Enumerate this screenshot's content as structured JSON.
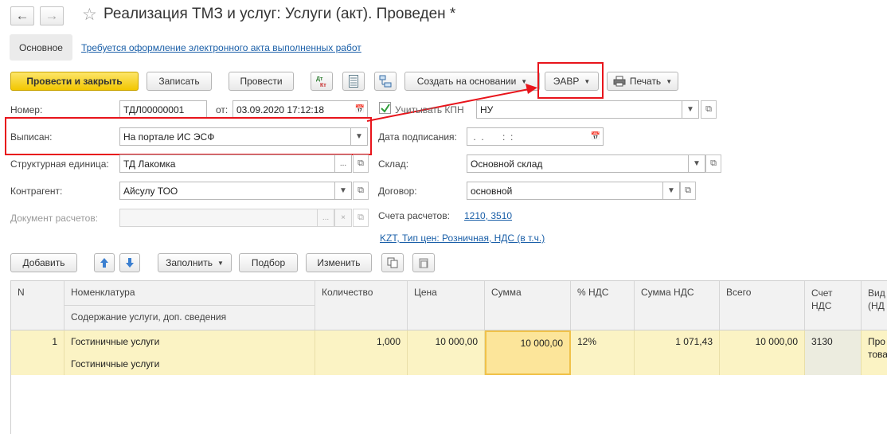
{
  "header": {
    "back_icon": "arrow-left-icon",
    "forward_icon": "arrow-right-icon",
    "favorite_icon": "star-icon",
    "title": "Реализация ТМЗ и услуг: Услуги (акт). Проведен *"
  },
  "tabs": {
    "main": "Основное",
    "link": "Требуется оформление электронного акта выполненных работ"
  },
  "toolbar": {
    "post_close": "Провести и закрыть",
    "save": "Записать",
    "post": "Провести",
    "dtkt_icon": "dt-kt-icon",
    "list_icon": "document-list-icon",
    "structure_icon": "structure-icon",
    "create_based": "Создать на основании",
    "eavr": "ЭАВР",
    "print_icon": "printer-icon",
    "print": "Печать"
  },
  "form": {
    "number_label": "Номер:",
    "number_value": "ТДЛ00000001",
    "from_label": "от:",
    "date_value": "03.09.2020 17:12:18",
    "kpn_label": "Учитывать КПН",
    "kpn_checked": true,
    "kpn_value": "НУ",
    "issued_label": "Выписан:",
    "issued_value": "На портале ИС ЭСФ",
    "sign_date_label": "Дата подписания:",
    "sign_date_value": " .  .       :  :",
    "unit_label": "Структурная единица:",
    "unit_value": "ТД Лакомка",
    "warehouse_label": "Склад:",
    "warehouse_value": "Основной склад",
    "counterparty_label": "Контрагент:",
    "counterparty_value": "Айсулу ТОО",
    "contract_label": "Договор:",
    "contract_value": "основной",
    "settlement_doc_label": "Документ расчетов:",
    "settlement_doc_value": "",
    "accounts_label": "Счета расчетов:",
    "accounts_link": "1210, 3510",
    "price_type_link": "KZT, Тип цен: Розничная, НДС (в т.ч.)"
  },
  "table_toolbar": {
    "add": "Добавить",
    "up_icon": "arrow-up-icon",
    "down_icon": "arrow-down-icon",
    "fill": "Заполнить",
    "selection": "Подбор",
    "change": "Изменить",
    "copy_icon": "copy-icon",
    "paste_icon": "paste-icon"
  },
  "table": {
    "columns": {
      "n": "N",
      "nomenclature": "Номенклатура",
      "content": "Содержание услуги, доп. сведения",
      "qty": "Количество",
      "price": "Цена",
      "sum": "Сумма",
      "vat_rate": "% НДС",
      "vat_sum": "Сумма НДС",
      "total": "Всего",
      "vat_account_1": "Счет",
      "vat_account_2": "НДС",
      "kind_1": "Вид",
      "kind_2": "(НД"
    },
    "rows": [
      {
        "n": "1",
        "nomenclature": "Гостиничные услуги",
        "content": "Гостиничные услуги",
        "qty": "1,000",
        "price": "10 000,00",
        "sum": "10 000,00",
        "vat_rate": "12%",
        "vat_sum": "1 071,43",
        "total": "10 000,00",
        "vat_account": "3130",
        "kind_1": "Про",
        "kind_2": "това"
      }
    ]
  },
  "colors": {
    "accent_yellow": "#f2c600",
    "highlight_red": "#e8141b",
    "link_blue": "#1a5fa8",
    "row_selected": "#fbf3c4"
  }
}
